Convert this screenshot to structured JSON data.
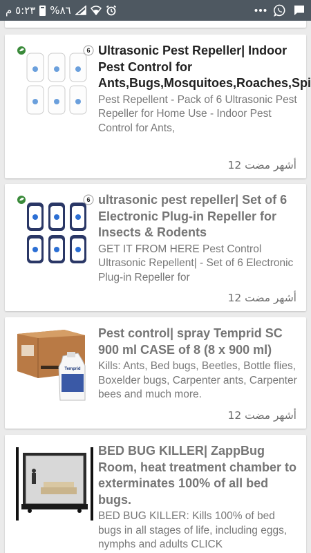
{
  "status_bar": {
    "time": "٥:٢٣ م",
    "battery_percent": "%٨٦",
    "icons": [
      "battery-icon",
      "signal-icon",
      "wifi-icon",
      "alarm-icon",
      "more-icon",
      "whatsapp-icon",
      "message-icon"
    ]
  },
  "posts": [
    {
      "title": "Ultrasonic Pest Repeller| Indoor Pest Control for Ants,Bugs,Mosquitoes,Roaches,Spiders,Mice,Rats",
      "description": "Pest Repellent - Pack of 6 Ultrasonic Pest Repeller for Home Use - Indoor Pest Control for Ants,",
      "time": "12 أشهر مضت",
      "thumb_badge": "6"
    },
    {
      "title": "ultrasonic pest repeller| Set of 6 Electronic Plug-in Repeller for Insects & Rodents",
      "description": "GET IT FROM HERE   Pest Control Ultrasonic Repellent| - Set of 6 Electronic Plug-in Repeller for",
      "time": "12 أشهر مضت",
      "thumb_badge": "6"
    },
    {
      "title": "Pest control| spray Temprid SC 900 ml CASE of 8 (8 x 900 ml)",
      "description": "Kills: Ants, Bed bugs, Beetles, Bottle flies, Boxelder bugs, Carpenter ants, Carpenter bees and much more.",
      "time": "12 أشهر مضت",
      "thumb_label": "Temprid"
    },
    {
      "title": "BED BUG KILLER| ZappBug Room, heat treatment chamber to exterminates 100% of all bed bugs.",
      "description": "BED BUG KILLER: Kills 100% of bed bugs in all stages of life, including eggs, nymphs and adults    CLICK"
    }
  ]
}
